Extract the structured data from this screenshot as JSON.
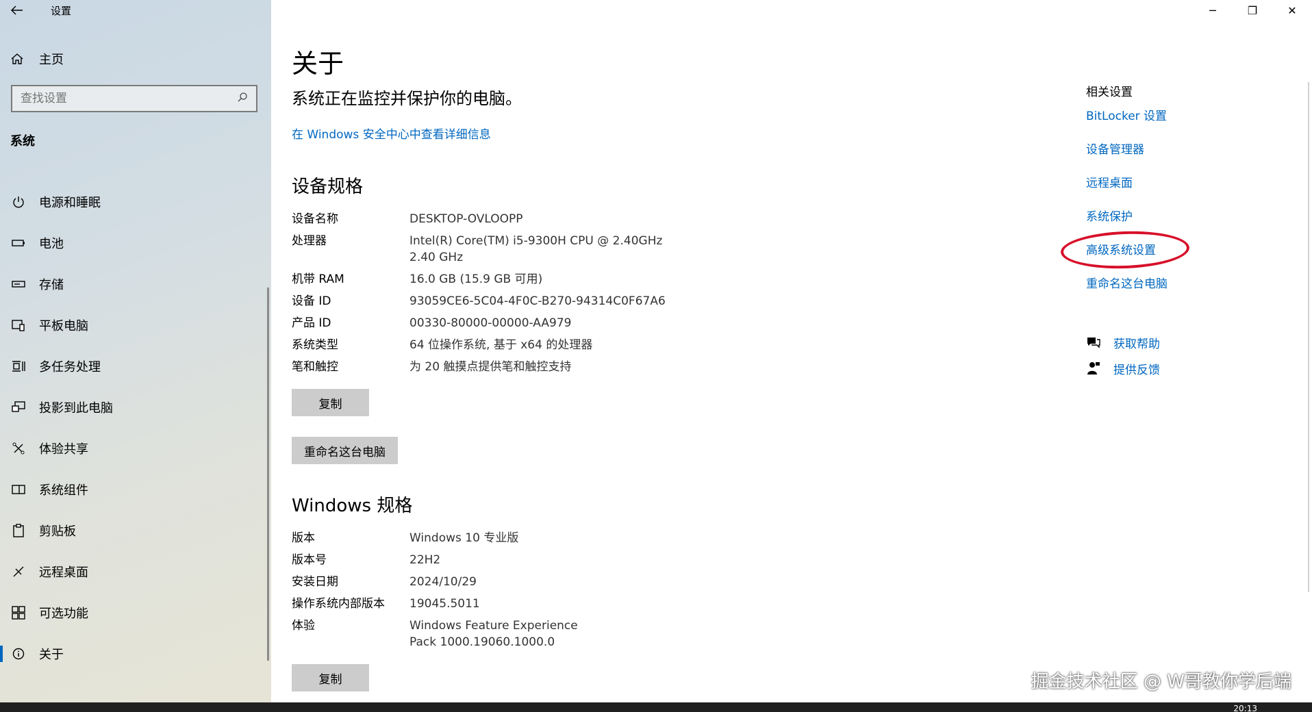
{
  "app": {
    "title": "设置"
  },
  "sidebar": {
    "home_label": "主页",
    "search_placeholder": "查找设置",
    "section": "系统",
    "items": [
      {
        "label": "电源和睡眠",
        "icon": "power-icon"
      },
      {
        "label": "电池",
        "icon": "battery-icon"
      },
      {
        "label": "存储",
        "icon": "storage-icon"
      },
      {
        "label": "平板电脑",
        "icon": "tablet-icon"
      },
      {
        "label": "多任务处理",
        "icon": "multitask-icon"
      },
      {
        "label": "投影到此电脑",
        "icon": "project-icon"
      },
      {
        "label": "体验共享",
        "icon": "share-icon"
      },
      {
        "label": "系统组件",
        "icon": "components-icon"
      },
      {
        "label": "剪贴板",
        "icon": "clipboard-icon"
      },
      {
        "label": "远程桌面",
        "icon": "remote-desktop-icon"
      },
      {
        "label": "可选功能",
        "icon": "optional-features-icon"
      },
      {
        "label": "关于",
        "icon": "info-icon"
      }
    ],
    "selected": "关于"
  },
  "main": {
    "title": "关于",
    "status": "系统正在监控并保护你的电脑。",
    "security_link": "在 Windows 安全中心中查看详细信息",
    "device_spec_heading": "设备规格",
    "device_specs": [
      {
        "k": "设备名称",
        "v": "DESKTOP-OVLOOPP"
      },
      {
        "k": "处理器",
        "v": "Intel(R) Core(TM) i5-9300H CPU @ 2.40GHz   2.40 GHz"
      },
      {
        "k": "机带 RAM",
        "v": "16.0 GB (15.9 GB 可用)"
      },
      {
        "k": "设备 ID",
        "v": "93059CE6-5C04-4F0C-B270-94314C0F67A6"
      },
      {
        "k": "产品 ID",
        "v": "00330-80000-00000-AA979"
      },
      {
        "k": "系统类型",
        "v": "64 位操作系统, 基于 x64 的处理器"
      },
      {
        "k": "笔和触控",
        "v": "为 20 触摸点提供笔和触控支持"
      }
    ],
    "copy_label": "复制",
    "rename_label": "重命名这台电脑",
    "windows_spec_heading": "Windows 规格",
    "windows_specs": [
      {
        "k": "版本",
        "v": "Windows 10 专业版"
      },
      {
        "k": "版本号",
        "v": "22H2"
      },
      {
        "k": "安装日期",
        "v": "2024/10/29"
      },
      {
        "k": "操作系统内部版本",
        "v": "19045.5011"
      },
      {
        "k": "体验",
        "v": "Windows Feature Experience Pack 1000.19060.1000.0"
      }
    ]
  },
  "related": {
    "heading": "相关设置",
    "links": [
      "BitLocker 设置",
      "设备管理器",
      "远程桌面",
      "系统保护",
      "高级系统设置",
      "重命名这台电脑"
    ],
    "help": "获取帮助",
    "feedback": "提供反馈"
  },
  "watermark": "掘金技术社区 @ W哥教你学后端",
  "taskbar": {
    "clock": "20:13"
  },
  "colors": {
    "accent": "#0067c0",
    "annotation": "#d8102a"
  }
}
